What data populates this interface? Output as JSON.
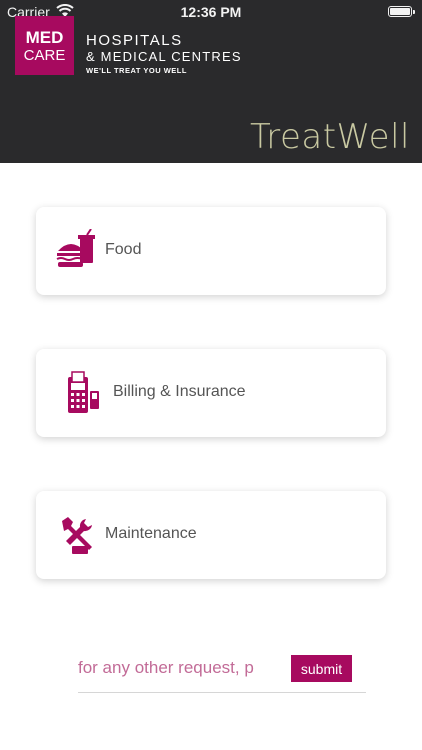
{
  "status_bar": {
    "carrier": "Carrier",
    "time": "12:36 PM"
  },
  "header": {
    "logo_line1": "MED",
    "logo_line2": "CARE",
    "title_line1": "HOSPITALS",
    "title_line2": "& MEDICAL CENTRES",
    "tagline": "WE'LL TREAT YOU WELL",
    "brand": "TreatWell"
  },
  "services": [
    {
      "label": "Food",
      "icon": "food-icon"
    },
    {
      "label": "Billing & Insurance",
      "icon": "billing-icon"
    },
    {
      "label": "Maintenance",
      "icon": "maintenance-icon"
    }
  ],
  "request": {
    "placeholder": "for any other request, p",
    "submit_label": "submit"
  },
  "colors": {
    "accent": "#a70a5f",
    "header_bg": "#2a2a2c",
    "brand_text": "#c9c9a2"
  }
}
